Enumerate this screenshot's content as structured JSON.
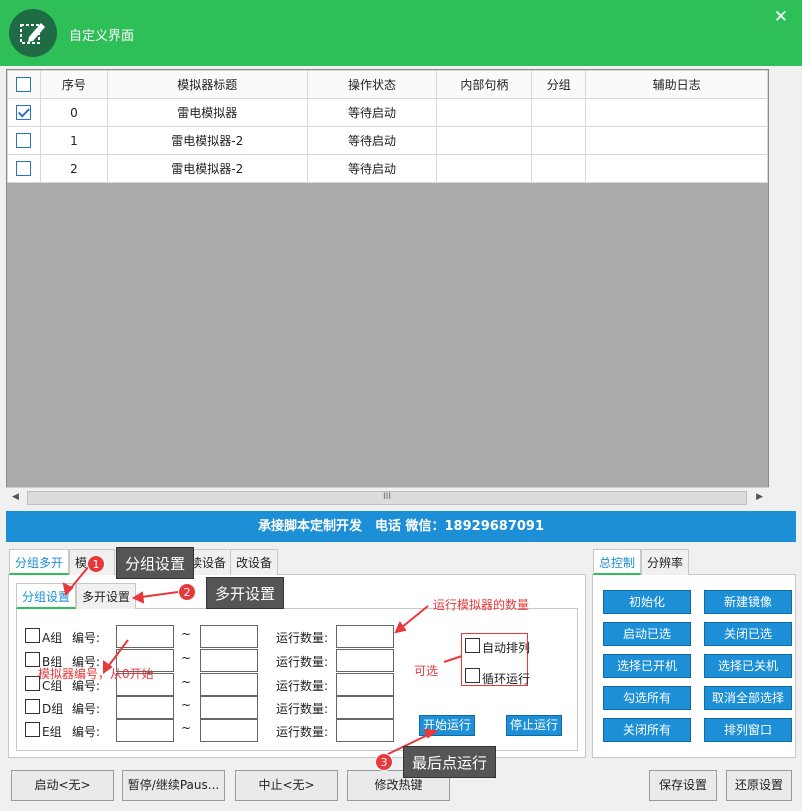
{
  "window": {
    "title": "自定义界面",
    "close_glyph": "✕"
  },
  "grid": {
    "columns": [
      "序号",
      "模拟器标题",
      "操作状态",
      "内部句柄",
      "分组",
      "辅助日志"
    ],
    "rows": [
      {
        "checked": true,
        "index": "0",
        "title": "雷电模拟器",
        "status": "等待启动",
        "handle": "",
        "group": "",
        "log": ""
      },
      {
        "checked": false,
        "index": "1",
        "title": "雷电模拟器-2",
        "status": "等待启动",
        "handle": "",
        "group": "",
        "log": ""
      },
      {
        "checked": false,
        "index": "2",
        "title": "雷电模拟器-2",
        "status": "等待启动",
        "handle": "",
        "group": "",
        "log": ""
      }
    ],
    "scroll_grip": "III"
  },
  "banner": "承接脚本定制开发　电话 微信：18929687091",
  "left_tabs": [
    "分组多开",
    "模",
    "读设备",
    "改设备"
  ],
  "sub_tabs": [
    "分组设置",
    "多开设置"
  ],
  "groups": [
    {
      "label": "A组",
      "id_label": "编号:",
      "tilde": "~",
      "count_label": "运行数量:"
    },
    {
      "label": "B组",
      "id_label": "编号:",
      "tilde": "~",
      "count_label": "运行数量:"
    },
    {
      "label": "C组",
      "id_label": "编号:",
      "tilde": "~",
      "count_label": "运行数量:"
    },
    {
      "label": "D组",
      "id_label": "编号:",
      "tilde": "~",
      "count_label": "运行数量:"
    },
    {
      "label": "E组",
      "id_label": "编号:",
      "tilde": "~",
      "count_label": "运行数量:"
    }
  ],
  "options": {
    "auto_arrange": "自动排列",
    "loop_run": "循环运行"
  },
  "run": {
    "start": "开始运行",
    "stop": "停止运行"
  },
  "right_tabs": [
    "总控制",
    "分辨率"
  ],
  "control_buttons": [
    "初始化",
    "新建镜像",
    "启动已选",
    "关闭已选",
    "选择已开机",
    "选择已关机",
    "勾选所有",
    "取消全部选择",
    "关闭所有",
    "排列窗口"
  ],
  "bottom_buttons": {
    "start": "启动<无>",
    "pause": "暂停/继续Paus...",
    "abort": "中止<无>",
    "hotkey": "修改热键",
    "save": "保存设置",
    "restore": "还原设置"
  },
  "annotations": {
    "badge1": "1",
    "callout1": "分组设置",
    "badge2": "2",
    "callout2": "多开设置",
    "badge3": "3",
    "callout3": "最后点运行",
    "note_count": "运行模拟器的数量",
    "note_id": "模拟器编号，从0开始",
    "note_optional": "可选"
  },
  "colors": {
    "title_green": "#2fbf58",
    "accent_blue": "#1c8fd6",
    "annotation_red": "#e8383a"
  }
}
